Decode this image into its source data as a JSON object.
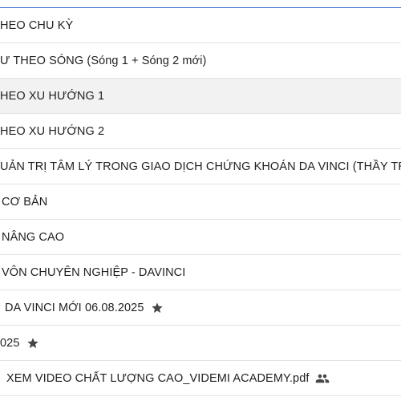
{
  "list": {
    "items": [
      {
        "label": "HEO CHU KỲ",
        "icon": null,
        "offset": 0
      },
      {
        "label": "Ư THEO SÓNG (Sóng 1 + Sóng 2 mới)",
        "icon": null,
        "offset": 0
      },
      {
        "label": "HEO XU HƯỚNG 1",
        "icon": null,
        "offset": 0
      },
      {
        "label": "HEO XU HƯỚNG 2",
        "icon": null,
        "offset": 0
      },
      {
        "label": "UẢN TRỊ TÂM LÝ TRONG GIAO DỊCH CHỨNG KHOÁN DA VINCI (THẦY TRẦN",
        "icon": null,
        "offset": 0
      },
      {
        "label": "CƠ BẢN",
        "icon": null,
        "offset": 0
      },
      {
        "label": "NÂNG CAO",
        "icon": null,
        "offset": 0
      },
      {
        "label": "VÔN CHUYÊN NGHIỆP - DAVINCI",
        "icon": null,
        "offset": 0
      },
      {
        "label": "DA VINCI MỚI 06.08.2025",
        "icon": "star-icon",
        "offset": 0
      },
      {
        "label": "025",
        "icon": "star-icon",
        "offset": 0
      },
      {
        "label": "XEM VIDEO CHẤT LƯỢNG CAO_VIDEMI ACADEMY.pdf",
        "icon": "shared-people-icon",
        "offset": 0
      }
    ]
  },
  "colors": {
    "top_border": "#4a7bd0",
    "row_border": "#e3e3e3",
    "hover_bg": "#f2f2f2",
    "icon": "#444746"
  }
}
